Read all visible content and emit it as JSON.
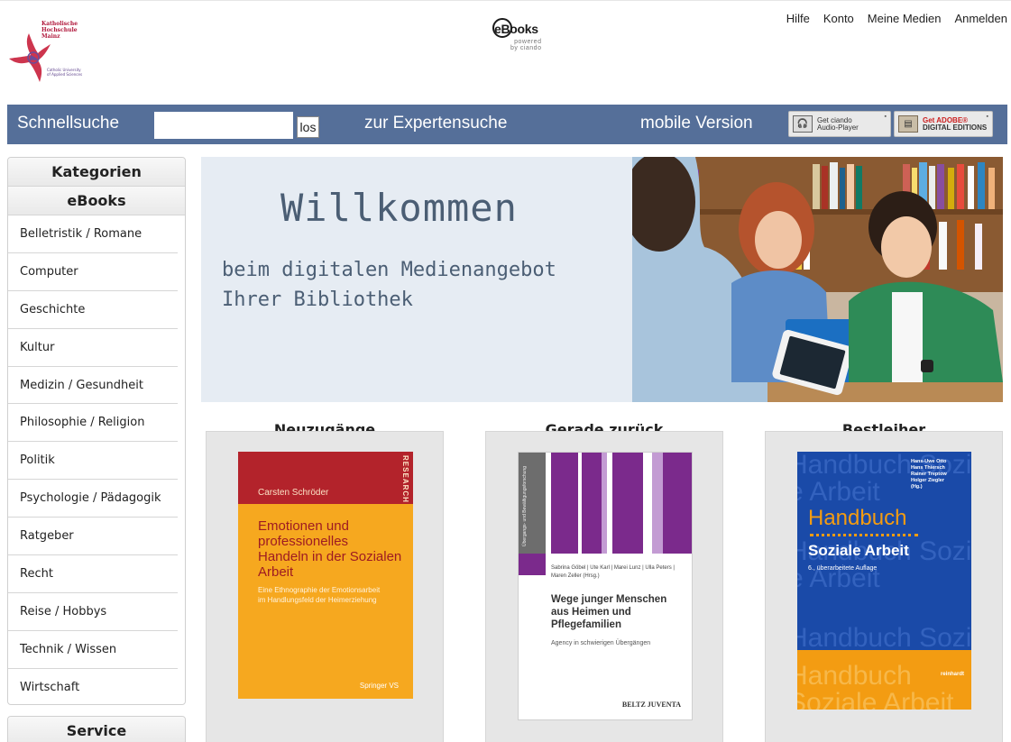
{
  "header": {
    "logo_text": "Katholische\nHochschule\nMainz",
    "logo_subtext": "Catholic University\nof Applied Sciences",
    "brand_word": "eBooks",
    "brand_sub": "powered\nby ciando",
    "links": [
      "Hilfe",
      "Konto",
      "Meine Medien",
      "Anmelden"
    ]
  },
  "navbar": {
    "quick_label": "Schnellsuche",
    "search_value": "",
    "go_label": "los",
    "expert_label": "zur Expertensuche",
    "mobile_label": "mobile Version",
    "badge1_line1": "Get ciando",
    "badge1_line2": "Audio-Player",
    "badge2_line1": "Get ADOBE®",
    "badge2_line2": "DIGITAL EDITIONS"
  },
  "sidebar": {
    "heading": "Kategorien",
    "subheading": "eBooks",
    "items": [
      "Belletristik / Romane",
      "Computer",
      "Geschichte",
      "Kultur",
      "Medizin / Gesundheit",
      "Philosophie / Religion",
      "Politik",
      "Psychologie / Pädagogik",
      "Ratgeber",
      "Recht",
      "Reise / Hobbys",
      "Technik / Wissen",
      "Wirtschaft"
    ],
    "service_heading": "Service"
  },
  "hero": {
    "title": "Willkommen",
    "line1": "beim digitalen Medienangebot",
    "line2": "Ihrer Bibliothek"
  },
  "columns": [
    {
      "title": "Neuzugänge",
      "book": {
        "author": "Carsten Schröder",
        "series": "RESEARCH",
        "title": "Emotionen und professionelles Handeln in der Sozialen Arbeit",
        "subtitle": "Eine Ethnographie der Emotionsarbeit im Handlungsfeld der Heimerziehung",
        "publisher": "Springer VS",
        "colors": {
          "top": "#b3232b",
          "body": "#f5a623",
          "title": "#9e1b22"
        }
      }
    },
    {
      "title": "Gerade zurück",
      "book": {
        "series_spine": "Übergangs- und Bewältigungsforschung",
        "authors": "Sabrina Göbel | Ute Karl | Marei Lunz | Ulla Peters | Maren Zeller (Hrsg.)",
        "title": "Wege junger Menschen aus Heimen und Pflegefamilien",
        "subtitle": "Agency in schwierigen Übergängen",
        "publisher": "BELTZ JUVENTA",
        "colors": {
          "accent": "#7b2a8c",
          "body": "#ffffff"
        }
      }
    },
    {
      "title": "Bestleiher",
      "book": {
        "editors": "Hans-Uwe Otto\nHans Thiersch\nRainer Treptow\nHolger Ziegler\n(Hg.)",
        "title_line1": "Handbuch",
        "title_line2": "Soziale Arbeit",
        "edition": "6., überarbeitete Auflage",
        "background_word": "Handbuch Soziale Arbeit",
        "publisher": "reinhardt",
        "colors": {
          "body": "#1a4aa8",
          "accent": "#f39c12"
        }
      }
    }
  ]
}
